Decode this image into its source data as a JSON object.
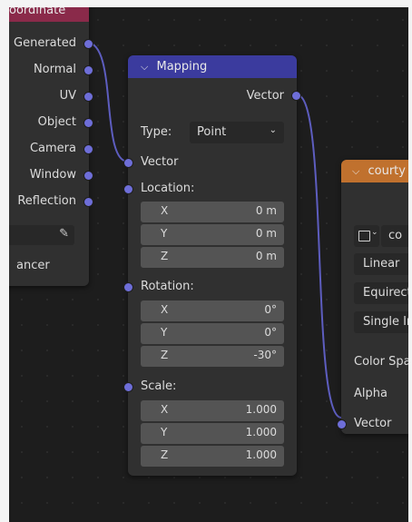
{
  "texcoord": {
    "title": "oordinate",
    "outputs": [
      "Generated",
      "Normal",
      "UV",
      "Object",
      "Camera",
      "Window",
      "Reflection"
    ],
    "instancer_label": "ancer"
  },
  "mapping": {
    "title": "Mapping",
    "output": "Vector",
    "type_label": "Type:",
    "type_value": "Point",
    "input_vector": "Vector",
    "location_label": "Location:",
    "location": [
      {
        "axis": "X",
        "value": "0 m"
      },
      {
        "axis": "Y",
        "value": "0 m"
      },
      {
        "axis": "Z",
        "value": "0 m"
      }
    ],
    "rotation_label": "Rotation:",
    "rotation": [
      {
        "axis": "X",
        "value": "0°"
      },
      {
        "axis": "Y",
        "value": "0°"
      },
      {
        "axis": "Z",
        "value": "-30°"
      }
    ],
    "scale_label": "Scale:",
    "scale": [
      {
        "axis": "X",
        "value": "1.000"
      },
      {
        "axis": "Y",
        "value": "1.000"
      },
      {
        "axis": "Z",
        "value": "1.000"
      }
    ]
  },
  "image_node": {
    "title": "courty",
    "image_name": "co",
    "interpolation": "Linear",
    "projection": "Equirect",
    "source": "Single In",
    "color_space_label": "Color Spa",
    "alpha_label": "Alpha",
    "vector_label": "Vector"
  },
  "colors": {
    "socket_vector": "#6e6ed8",
    "header_texcoord": "#8a2a4a",
    "header_mapping": "#3b3b9e",
    "header_image": "#c0712e",
    "wire": "#5d5dbf"
  }
}
